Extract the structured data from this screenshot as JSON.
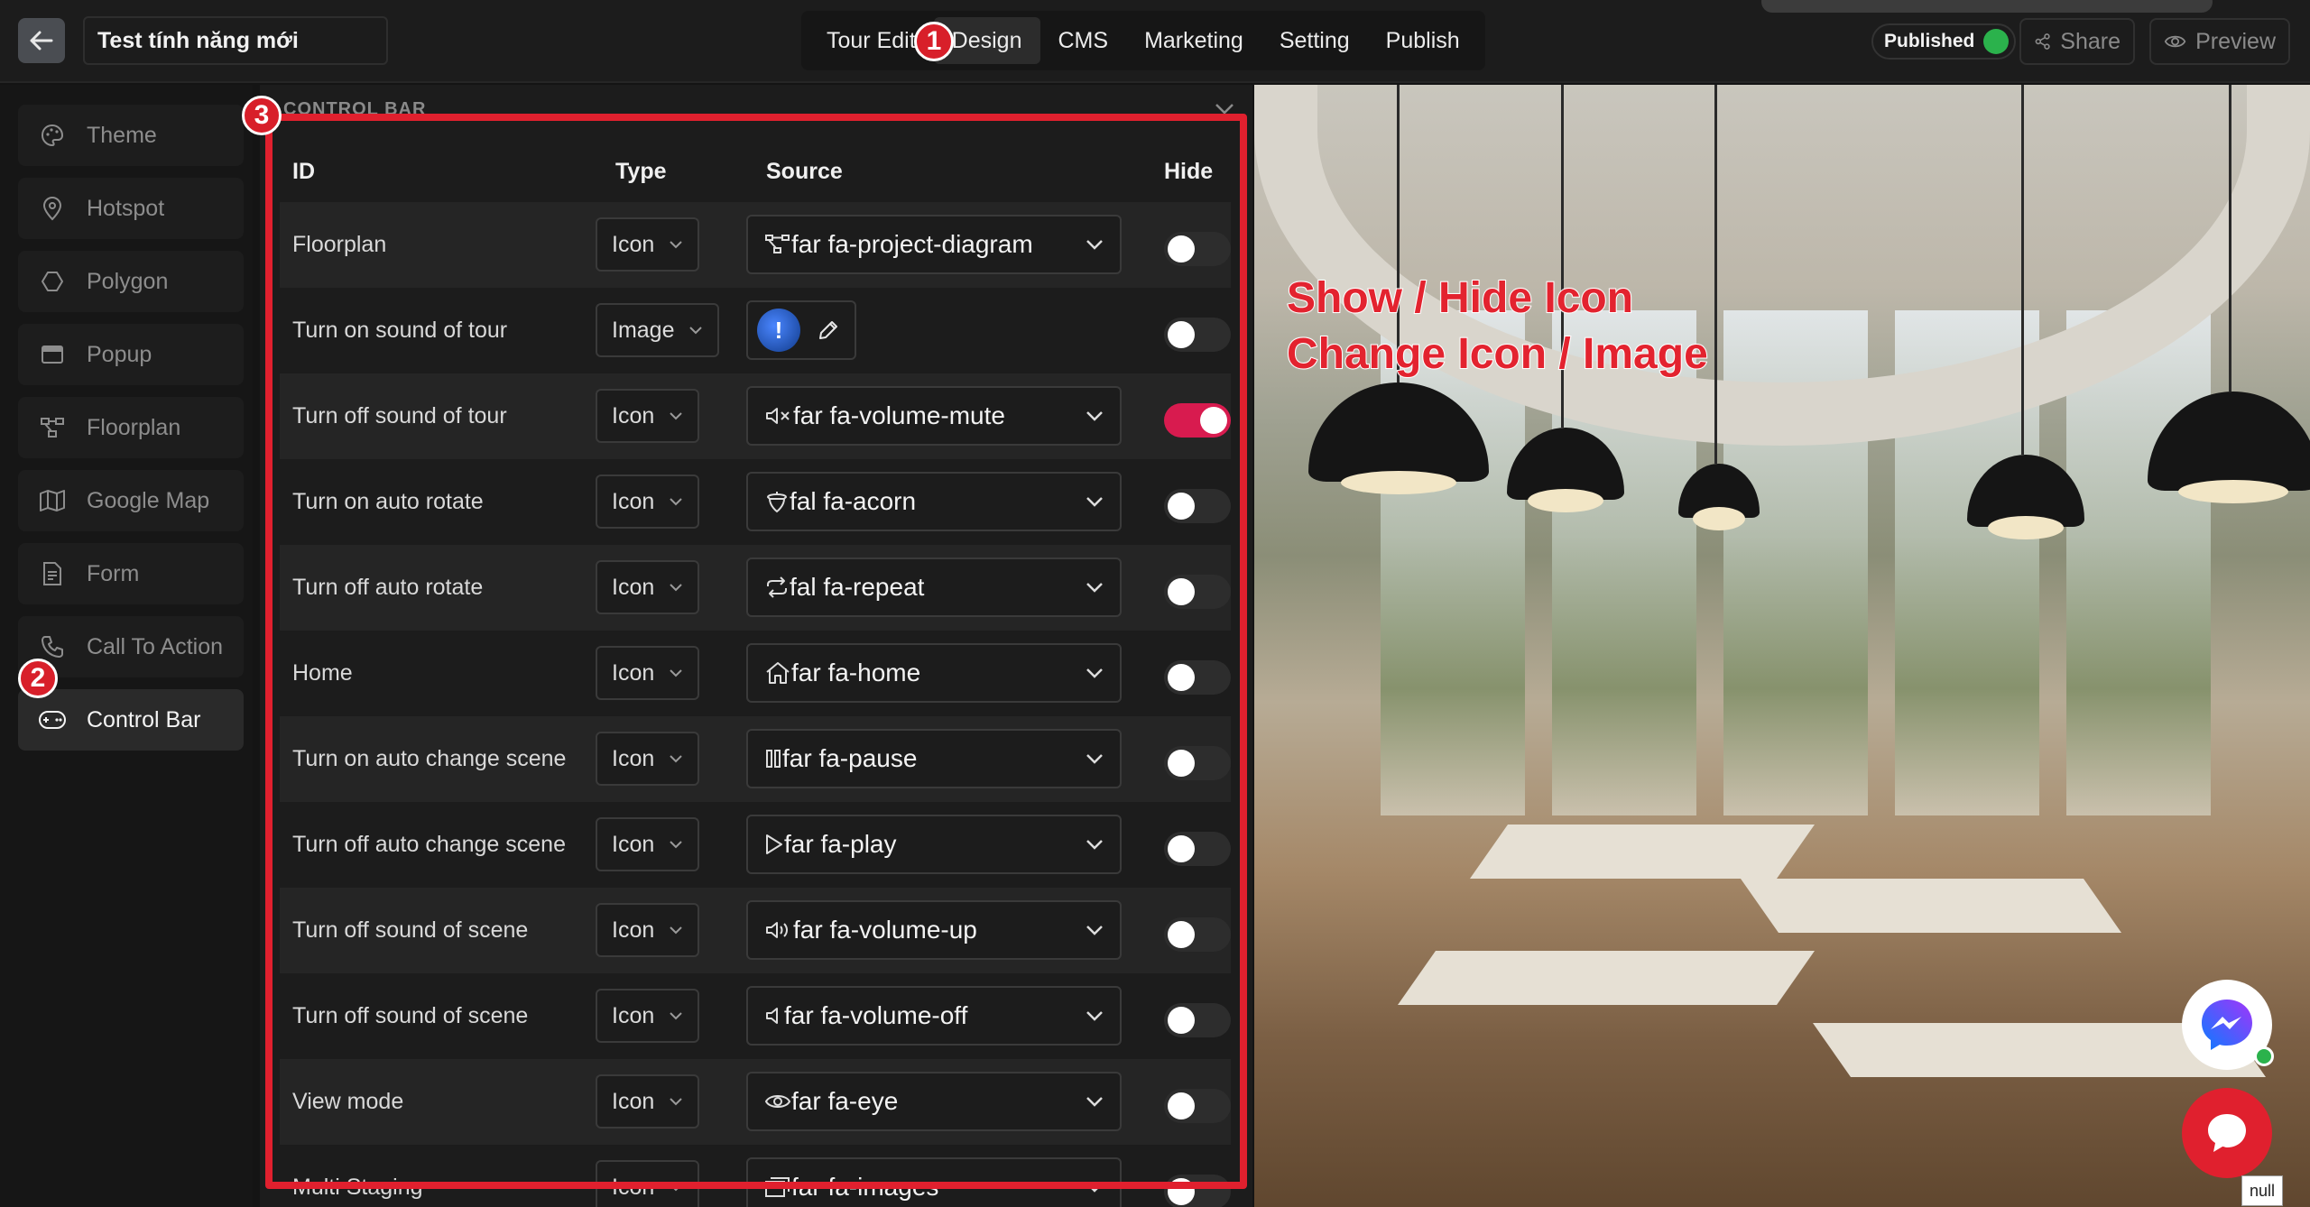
{
  "header": {
    "tour_name": "Test tính năng mới",
    "nav": [
      "Tour Edit",
      "Design",
      "CMS",
      "Marketing",
      "Setting",
      "Publish"
    ],
    "active_nav": "Design",
    "status": "Published",
    "share_label": "Share",
    "preview_label": "Preview"
  },
  "sidebar": {
    "items": [
      {
        "label": "Theme",
        "icon": "palette-icon"
      },
      {
        "label": "Hotspot",
        "icon": "map-pin-icon"
      },
      {
        "label": "Polygon",
        "icon": "hexagon-icon"
      },
      {
        "label": "Popup",
        "icon": "window-icon"
      },
      {
        "label": "Floorplan",
        "icon": "project-diagram-icon"
      },
      {
        "label": "Google Map",
        "icon": "map-icon"
      },
      {
        "label": "Form",
        "icon": "form-icon"
      },
      {
        "label": "Call To Action",
        "icon": "phone-icon"
      },
      {
        "label": "Control Bar",
        "icon": "gamepad-icon"
      }
    ],
    "active": "Control Bar"
  },
  "panel": {
    "title": "CONTROL BAR",
    "columns": {
      "id": "ID",
      "type": "Type",
      "source": "Source",
      "hide": "Hide"
    },
    "rows": [
      {
        "id": "Floorplan",
        "type": "Icon",
        "source": "far fa-project-diagram",
        "icon": "project-diagram-icon",
        "hide": false
      },
      {
        "id": "Turn on sound of tour",
        "type": "Image",
        "source": "",
        "icon": "image-thumbnail",
        "hide": false
      },
      {
        "id": "Turn off sound of tour",
        "type": "Icon",
        "source": "far fa-volume-mute",
        "icon": "volume-mute-icon",
        "hide": true
      },
      {
        "id": "Turn on auto rotate",
        "type": "Icon",
        "source": "fal fa-acorn",
        "icon": "acorn-icon",
        "hide": false
      },
      {
        "id": "Turn off auto rotate",
        "type": "Icon",
        "source": "fal fa-repeat",
        "icon": "repeat-icon",
        "hide": false
      },
      {
        "id": "Home",
        "type": "Icon",
        "source": "far fa-home",
        "icon": "home-icon",
        "hide": false
      },
      {
        "id": "Turn on auto change scene",
        "type": "Icon",
        "source": "far fa-pause",
        "icon": "pause-icon",
        "hide": false
      },
      {
        "id": "Turn off auto change scene",
        "type": "Icon",
        "source": "far fa-play",
        "icon": "play-icon",
        "hide": false
      },
      {
        "id": "Turn off sound of scene",
        "type": "Icon",
        "source": "far fa-volume-up",
        "icon": "volume-up-icon",
        "hide": false
      },
      {
        "id": "Turn off sound of scene",
        "type": "Icon",
        "source": "far fa-volume-off",
        "icon": "volume-off-icon",
        "hide": false
      },
      {
        "id": "View mode",
        "type": "Icon",
        "source": "far fa-eye",
        "icon": "eye-icon",
        "hide": false
      },
      {
        "id": "Multi Staging",
        "type": "Icon",
        "source": "far fa-images",
        "icon": "images-icon",
        "hide": false
      }
    ]
  },
  "annotations": {
    "badges": [
      "1",
      "2",
      "3"
    ],
    "overlay_lines": [
      "Show / Hide Icon",
      "Change Icon / Image"
    ],
    "color": "#e0202e"
  },
  "preview": {
    "null_tag": "null"
  },
  "colors": {
    "toggle_on": "#d81b4f",
    "published_dot": "#2bb24c",
    "background": "#141414"
  }
}
